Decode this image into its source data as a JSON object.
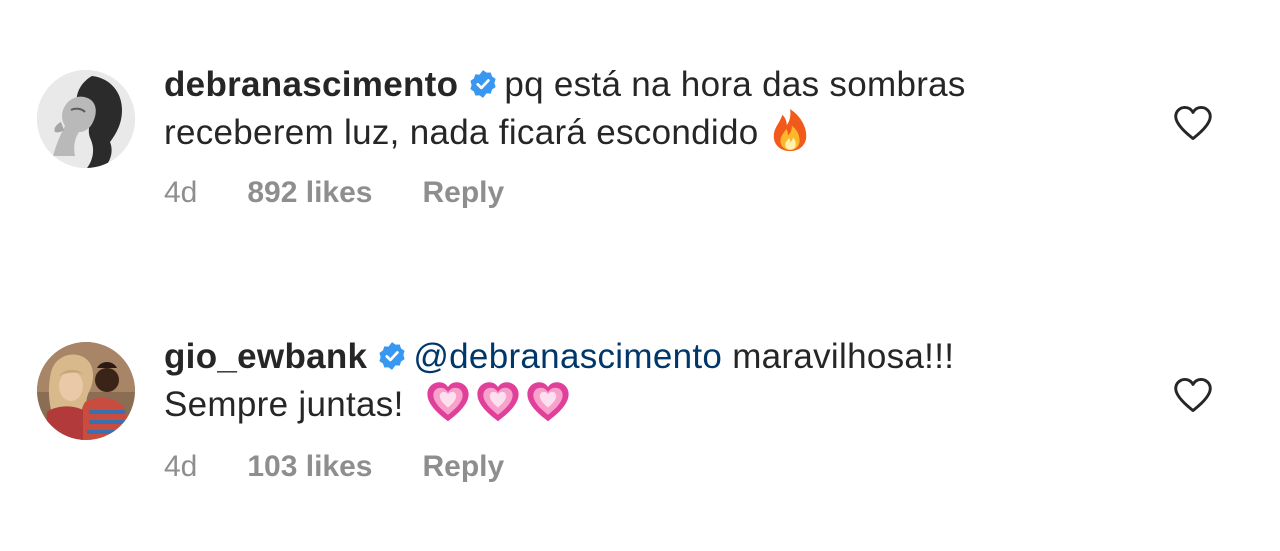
{
  "comments": [
    {
      "username": "debranascimento",
      "verified": true,
      "text_line1": "pq está na hora das sombras",
      "text_line2": "receberem luz, nada ficará escondido",
      "emoji": "fire",
      "time": "4d",
      "likes": "892 likes",
      "reply_label": "Reply",
      "like_icon": "heart-outline-icon"
    },
    {
      "username": "gio_ewbank",
      "verified": true,
      "mention": "@debranascimento",
      "text_line1": "maravilhosa!!!",
      "text_line2": "Sempre juntas!",
      "emoji": "growing-heart x3",
      "time": "4d",
      "likes": "103 likes",
      "reply_label": "Reply",
      "like_icon": "heart-outline-icon"
    }
  ],
  "colors": {
    "text": "#262626",
    "secondary": "#8e8e8e",
    "mention": "#00376b",
    "verified": "#3897f0"
  }
}
